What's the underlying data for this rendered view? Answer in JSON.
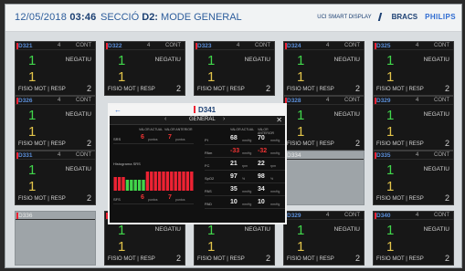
{
  "header": {
    "date": "12/05/2018",
    "time": "03:46",
    "section_prefix": "SECCIÓ",
    "section_id": "D2:",
    "section_mode": "MODE GENERAL",
    "display_label": "UCI SMART DISPLAY",
    "brand": "BRACS",
    "philips": "PHILIPS"
  },
  "bed_common": {
    "n": "4",
    "cont": "CONT",
    "value1": "1",
    "status": "NEGATIU",
    "value2": "1",
    "fisio": "FISIO MOT | RESP",
    "count": "2"
  },
  "beds": [
    {
      "id": "D321"
    },
    {
      "id": "D322"
    },
    {
      "id": "D323"
    },
    {
      "id": "D324"
    },
    {
      "id": "D325"
    },
    {
      "id": "D326"
    },
    {
      "id": "D328"
    },
    {
      "id": "D329"
    },
    {
      "id": "D330"
    },
    {
      "id": "D331"
    },
    {
      "id": "D334"
    },
    {
      "id": "D335"
    },
    {
      "id": "D336"
    },
    {
      "id": "D329"
    },
    {
      "id": "D340"
    }
  ],
  "overlay": {
    "back": "←",
    "title": "D341",
    "nav_left": "‹",
    "tab": "GENERAL",
    "nav_right": "›",
    "close": "✕",
    "col_a": "VALOR ACTUAL",
    "col_b": "VALOR ANTERIOR",
    "left_rows": [
      {
        "label": "SRS",
        "v1": "6",
        "u1": "puntos",
        "v2": "7",
        "u2": "puntos"
      },
      {
        "label": "SFS",
        "v1": "6",
        "u1": "puntos",
        "v2": "7",
        "u2": "puntos"
      }
    ],
    "chart_label": "Histograma SRS",
    "right_rows": [
      {
        "label": "PI",
        "v1": "68",
        "u1": "mmHg",
        "v2": "70",
        "u2": "mmHg",
        "alert": false
      },
      {
        "label": "PAm",
        "v1": "-33",
        "u1": "mmHg",
        "v2": "-32",
        "u2": "mmHg",
        "alert": true
      },
      {
        "label": "FC",
        "v1": "21",
        "u1": "rpm",
        "v2": "22",
        "u2": "rpm",
        "alert": false
      },
      {
        "label": "SpO2",
        "v1": "97",
        "u1": "%",
        "v2": "98",
        "u2": "%",
        "alert": false
      },
      {
        "label": "PAS",
        "v1": "35",
        "u1": "mmHg",
        "v2": "34",
        "u2": "mmHg",
        "alert": false
      },
      {
        "label": "PAD",
        "v1": "10",
        "u1": "mmHg",
        "v2": "10",
        "u2": "mmHg",
        "alert": false
      }
    ]
  },
  "chart_data": {
    "type": "bar",
    "values": [
      5,
      5,
      5,
      4,
      4,
      4,
      4,
      4,
      7,
      7,
      7,
      7,
      7,
      7,
      7,
      7,
      7,
      7,
      7,
      7
    ],
    "colors": [
      "#e23",
      "#e23",
      "#e23",
      "#41d64b",
      "#41d64b",
      "#41d64b",
      "#41d64b",
      "#41d64b",
      "#e23",
      "#e23",
      "#e23",
      "#e23",
      "#e23",
      "#e23",
      "#e23",
      "#e23",
      "#e23",
      "#e23",
      "#e23",
      "#e23"
    ]
  }
}
